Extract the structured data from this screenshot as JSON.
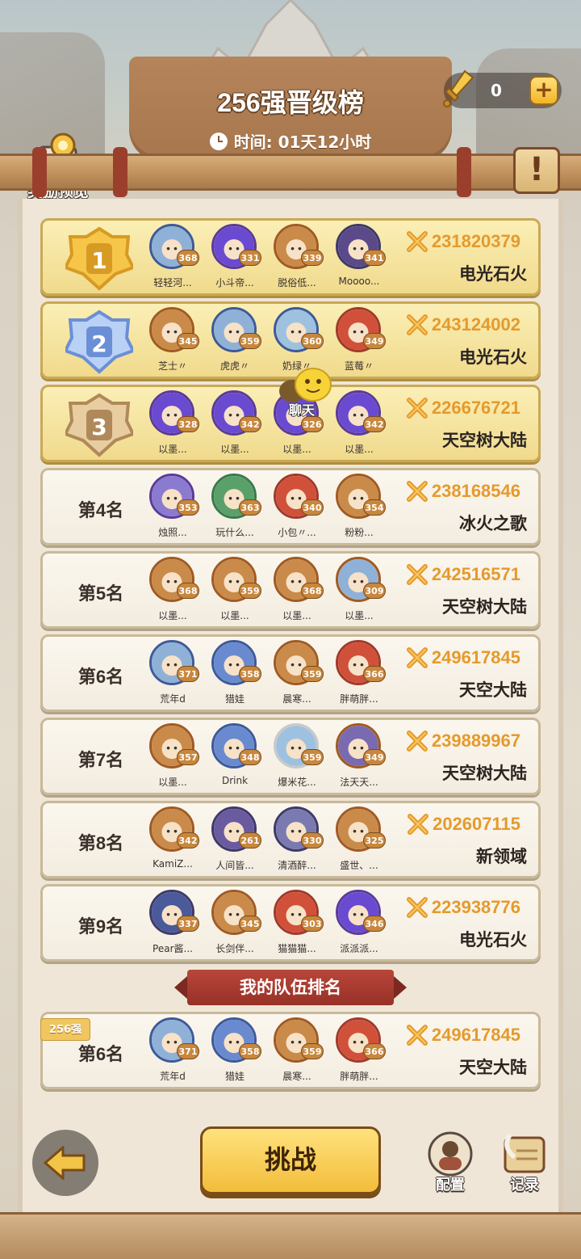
{
  "header": {
    "title": "256强晋级榜",
    "timer": "时间: 01天12小时",
    "currency_value": "0",
    "reward_label": "奖励预览"
  },
  "chat": {
    "label": "聊天"
  },
  "rows": [
    {
      "rank": "1",
      "medal": "gold",
      "power": "231820379",
      "server": "电光石火",
      "members": [
        {
          "name": "轻轻河...",
          "level": "368",
          "ring": "#3d5a9a",
          "face": "#8fb1d8"
        },
        {
          "name": "小斗帝...",
          "level": "331",
          "ring": "#5a3b9a",
          "face": "#6a4ad0"
        },
        {
          "name": "脱俗低...",
          "level": "339",
          "ring": "#a05a22",
          "face": "#c98a4a"
        },
        {
          "name": "Moooo...",
          "level": "341",
          "ring": "#3d3a6a",
          "face": "#5a4a8a"
        }
      ]
    },
    {
      "rank": "2",
      "medal": "silver",
      "power": "243124002",
      "server": "电光石火",
      "members": [
        {
          "name": "芝士〃",
          "level": "345",
          "ring": "#a05a22",
          "face": "#c98a4a"
        },
        {
          "name": "虎虎〃",
          "level": "359",
          "ring": "#3d5a9a",
          "face": "#8fb1d8"
        },
        {
          "name": "奶绿〃",
          "level": "360",
          "ring": "#3d5a9a",
          "face": "#9fc1e0"
        },
        {
          "name": "蓝莓〃",
          "level": "349",
          "ring": "#a03a2a",
          "face": "#d0503a"
        }
      ]
    },
    {
      "rank": "3",
      "medal": "bronze",
      "power": "226676721",
      "server": "天空树大陆",
      "members": [
        {
          "name": "以墨...",
          "level": "328",
          "ring": "#5a3b9a",
          "face": "#6a4ad0"
        },
        {
          "name": "以墨...",
          "level": "342",
          "ring": "#5a3b9a",
          "face": "#6a4ad0"
        },
        {
          "name": "以墨...",
          "level": "326",
          "ring": "#5a3b9a",
          "face": "#6a4ad0"
        },
        {
          "name": "以墨...",
          "level": "342",
          "ring": "#5a3b9a",
          "face": "#6a4ad0"
        }
      ]
    },
    {
      "rank": "第4名",
      "power": "238168546",
      "server": "冰火之歌",
      "members": [
        {
          "name": "烛照...",
          "level": "353",
          "ring": "#5a3b9a",
          "face": "#8a7ad0"
        },
        {
          "name": "玩什么...",
          "level": "363",
          "ring": "#3a7a4a",
          "face": "#5aa06a"
        },
        {
          "name": "小包〃...",
          "level": "340",
          "ring": "#a03a2a",
          "face": "#d0503a"
        },
        {
          "name": "粉粉...",
          "level": "354",
          "ring": "#a05a22",
          "face": "#c98a4a"
        }
      ]
    },
    {
      "rank": "第5名",
      "power": "242516571",
      "server": "天空树大陆",
      "members": [
        {
          "name": "以墨...",
          "level": "368",
          "ring": "#a05a22",
          "face": "#c98a4a"
        },
        {
          "name": "以墨...",
          "level": "359",
          "ring": "#a05a22",
          "face": "#c98a4a"
        },
        {
          "name": "以墨...",
          "level": "368",
          "ring": "#a05a22",
          "face": "#c98a4a"
        },
        {
          "name": "以墨...",
          "level": "309",
          "ring": "#a05a22",
          "face": "#8fb1d8"
        }
      ]
    },
    {
      "rank": "第6名",
      "power": "249617845",
      "server": "天空大陆",
      "members": [
        {
          "name": "荒年d",
          "level": "371",
          "ring": "#3d5a9a",
          "face": "#8fb1d8"
        },
        {
          "name": "猎娃",
          "level": "358",
          "ring": "#3d5a9a",
          "face": "#6a8ad0"
        },
        {
          "name": "晨寒...",
          "level": "359",
          "ring": "#a05a22",
          "face": "#c98a4a"
        },
        {
          "name": "胖萌胖...",
          "level": "366",
          "ring": "#a03a2a",
          "face": "#d0503a"
        }
      ]
    },
    {
      "rank": "第7名",
      "power": "239889967",
      "server": "天空树大陆",
      "members": [
        {
          "name": "以墨...",
          "level": "357",
          "ring": "#a05a22",
          "face": "#c98a4a"
        },
        {
          "name": "Drink",
          "level": "348",
          "ring": "#3d5a9a",
          "face": "#6a8ad0"
        },
        {
          "name": "爆米花...",
          "level": "359",
          "ring": "#c9c9c9",
          "face": "#9fc1e0"
        },
        {
          "name": "法天天...",
          "level": "349",
          "ring": "#a05a22",
          "face": "#7a6ab0"
        }
      ]
    },
    {
      "rank": "第8名",
      "power": "202607115",
      "server": "新领域",
      "members": [
        {
          "name": "KamiZ...",
          "level": "342",
          "ring": "#a05a22",
          "face": "#c98a4a"
        },
        {
          "name": "人间皆...",
          "level": "261",
          "ring": "#3d3a6a",
          "face": "#6a5aa0"
        },
        {
          "name": "清酒醉...",
          "level": "330",
          "ring": "#3d3a6a",
          "face": "#7a7ab0"
        },
        {
          "name": "盛世、...",
          "level": "325",
          "ring": "#a05a22",
          "face": "#c98a4a"
        }
      ]
    },
    {
      "rank": "第9名",
      "power": "223938776",
      "server": "电光石火",
      "members": [
        {
          "name": "Pear酱...",
          "level": "337",
          "ring": "#3d3a6a",
          "face": "#4a5a9a"
        },
        {
          "name": "长剑伴...",
          "level": "345",
          "ring": "#a05a22",
          "face": "#c98a4a"
        },
        {
          "name": "猫猫猫...",
          "level": "303",
          "ring": "#a03a2a",
          "face": "#d0503a"
        },
        {
          "name": "派派派...",
          "level": "346",
          "ring": "#5a3b9a",
          "face": "#6a4ad0"
        }
      ]
    }
  ],
  "my_team": {
    "section_title": "我的队伍排名",
    "tag": "256强",
    "rank": "第6名",
    "power": "249617845",
    "server": "天空大陆",
    "members": [
      {
        "name": "荒年d",
        "level": "371",
        "ring": "#3d5a9a",
        "face": "#8fb1d8"
      },
      {
        "name": "猎娃",
        "level": "358",
        "ring": "#3d5a9a",
        "face": "#6a8ad0"
      },
      {
        "name": "晨寒...",
        "level": "359",
        "ring": "#a05a22",
        "face": "#c98a4a"
      },
      {
        "name": "胖萌胖...",
        "level": "366",
        "ring": "#a03a2a",
        "face": "#d0503a"
      }
    ]
  },
  "bottom": {
    "challenge_label": "挑战",
    "config_label": "配置",
    "record_label": "记录"
  },
  "colors": {
    "power_text": "#e59a2c",
    "gold_row": "#f0da8c",
    "plain_row": "#f3ece0"
  }
}
